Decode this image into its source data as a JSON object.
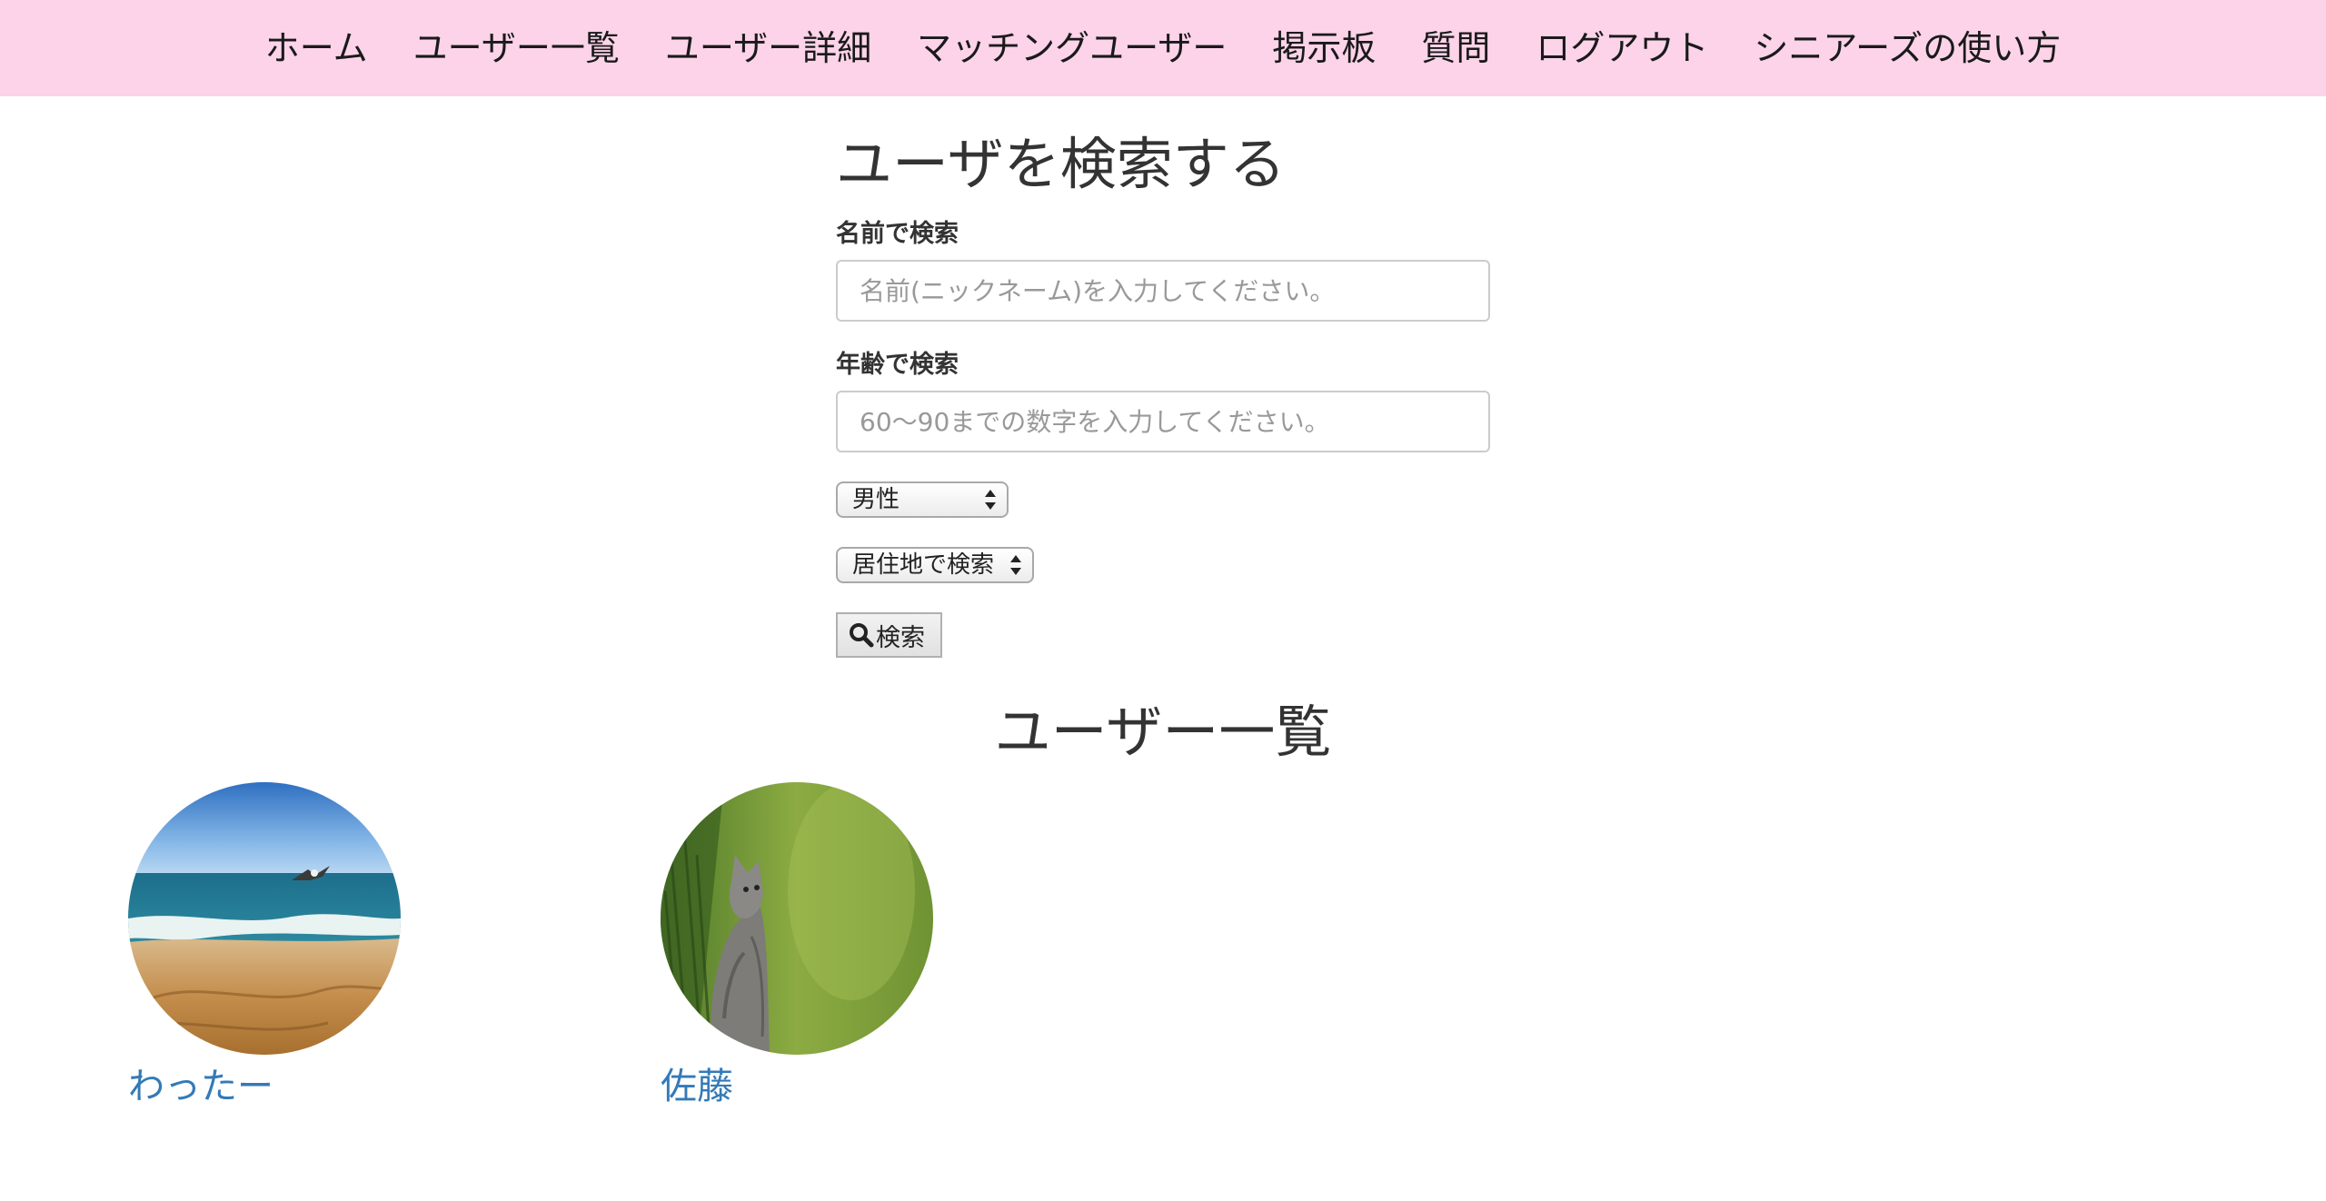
{
  "nav": {
    "items": [
      {
        "label": "ホーム"
      },
      {
        "label": "ユーザー一覧"
      },
      {
        "label": "ユーザー詳細"
      },
      {
        "label": "マッチングユーザー"
      },
      {
        "label": "掲示板"
      },
      {
        "label": "質問"
      },
      {
        "label": "ログアウト"
      },
      {
        "label": "シニアーズの使い方"
      }
    ],
    "background": "#fcd3e9"
  },
  "search": {
    "title": "ユーザを検索する",
    "name_label": "名前で検索",
    "name_placeholder": "名前(ニックネーム)を入力してください。",
    "name_value": "",
    "age_label": "年齢で検索",
    "age_placeholder": "60〜90までの数字を入力してください。",
    "age_value": "",
    "gender_selected": "男性",
    "residence_selected": "居住地で検索",
    "button_label": "検索",
    "button_icon": "search-icon"
  },
  "user_list": {
    "title": "ユーザー一覧",
    "users": [
      {
        "name": "わったー",
        "avatar": "beach-seagull-photo"
      },
      {
        "name": "佐藤",
        "avatar": "kitten-grass-photo"
      }
    ]
  },
  "colors": {
    "link": "#337ab7",
    "text": "#333333"
  }
}
